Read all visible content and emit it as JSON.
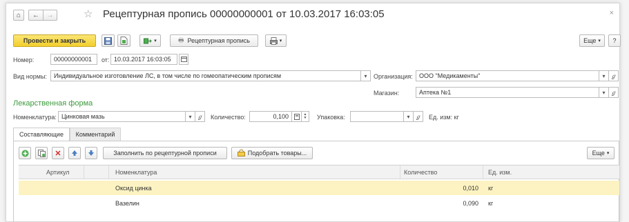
{
  "window": {
    "title": "Рецептурная пропись 00000000001 от 10.03.2017 16:03:05",
    "home_glyph": "⌂",
    "back_glyph": "←",
    "forward_glyph": "→",
    "star_glyph": "☆",
    "close_glyph": "×"
  },
  "toolbar": {
    "post_close_label": "Провести и закрыть",
    "recipe_label": "Рецептурная пропись",
    "more_label": "Еще",
    "help_label": "?"
  },
  "header": {
    "number_label": "Номер:",
    "number_value": "00000000001",
    "date_label": "от:",
    "date_value": "10.03.2017 16:03:05",
    "norm_label": "Вид нормы:",
    "norm_value": "Индивидуальное изготовление ЛС, в том числе по гомеопатическим прописям",
    "org_label": "Организация:",
    "org_value": "ООО \"Медикаменты\"",
    "store_label": "Магазин:",
    "store_value": "Аптека №1"
  },
  "dosage_form": {
    "section_title": "Лекарственная форма",
    "nomenclature_label": "Номенклатура:",
    "nomenclature_value": "Цинковая мазь",
    "quantity_label": "Количество:",
    "quantity_value": "0,100",
    "package_label": "Упаковка:",
    "package_value": "",
    "unit_label": "Ед. изм:",
    "unit_value": "кг"
  },
  "tabs": [
    {
      "label": "Составляющие",
      "active": true
    },
    {
      "label": "Комментарий",
      "active": false
    }
  ],
  "grid_toolbar": {
    "fill_label": "Заполнить по рецептурной прописи",
    "pick_label": "Подобрать товары...",
    "more_label": "Еще"
  },
  "table": {
    "columns": [
      "Артикул",
      "Номенклатура",
      "Количество",
      "Ед. изм."
    ],
    "rows": [
      {
        "article": "",
        "nomenclature": "Оксид цинка",
        "quantity": "0,010",
        "unit": "кг",
        "selected": true
      },
      {
        "article": "",
        "nomenclature": "Вазелин",
        "quantity": "0,090",
        "unit": "кг",
        "selected": false
      }
    ]
  },
  "colors": {
    "primary_button": "#f2cf2c",
    "section_title": "#3c9a3c",
    "selected_row": "#fdf3c2"
  }
}
